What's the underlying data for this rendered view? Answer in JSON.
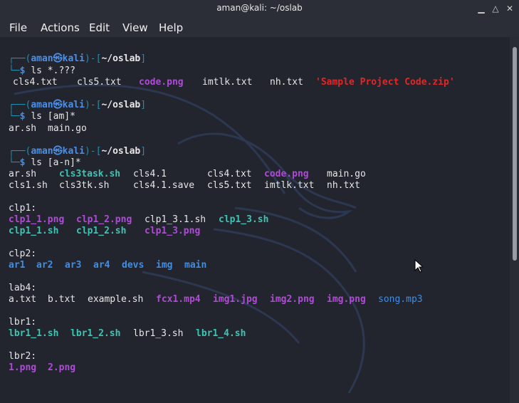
{
  "window": {
    "title": "aman@kali: ~/oslab"
  },
  "menubar": {
    "items": [
      "File",
      "Actions",
      "Edit",
      "View",
      "Help"
    ]
  },
  "colors": {
    "background": "#23252e",
    "prompt": "#1f8fb0",
    "directory": "#3d8ee8",
    "executable": "#3cc4b4",
    "image": "#b04ad8",
    "archive": "#e02828"
  },
  "terminal": {
    "prompts": [
      {
        "user": "aman",
        "host": "kali",
        "path": "~/oslab",
        "command": "ls *.???"
      },
      {
        "user": "aman",
        "host": "kali",
        "path": "~/oslab",
        "command": "ls [am]*"
      },
      {
        "user": "aman",
        "host": "kali",
        "path": "~/oslab",
        "command": "ls [a-n]*"
      }
    ],
    "out1": [
      "cls4.txt",
      "cls5.txt",
      "code.png",
      "imtlk.txt",
      "nh.txt",
      "'Sample Project Code.zip'"
    ],
    "out2": [
      "ar.sh",
      "main.go"
    ],
    "out3_row1": [
      "ar.sh",
      "cls3task.sh",
      "cls4.1",
      "cls4.txt",
      "code.png",
      "main.go"
    ],
    "out3_row2": [
      "cls1.sh",
      "cls3tk.sh",
      "cls4.1.save",
      "cls5.txt",
      "imtlk.txt",
      "nh.txt"
    ],
    "clp1": {
      "header": "clp1:",
      "row1": [
        "clp1_1.png",
        "clp1_2.png",
        "clp1_3.1.sh",
        "clp1_3.sh"
      ],
      "row2": [
        "clp1_1.sh",
        "clp1_2.sh",
        "clp1_3.png"
      ]
    },
    "clp2": {
      "header": "clp2:",
      "items": [
        "ar1",
        "ar2",
        "ar3",
        "ar4",
        "devs",
        "img",
        "main"
      ]
    },
    "lab4": {
      "header": "lab4:",
      "items": [
        "a.txt",
        "b.txt",
        "example.sh",
        "fcx1.mp4",
        "img1.jpg",
        "img2.png",
        "img.png",
        "song.mp3"
      ]
    },
    "lbr1": {
      "header": "lbr1:",
      "items": [
        "lbr1_1.sh",
        "lbr1_2.sh",
        "lbr1_3.sh",
        "lbr1_4.sh"
      ]
    },
    "lbr2": {
      "header": "lbr2:",
      "items": [
        "1.png",
        "2.png"
      ]
    }
  }
}
